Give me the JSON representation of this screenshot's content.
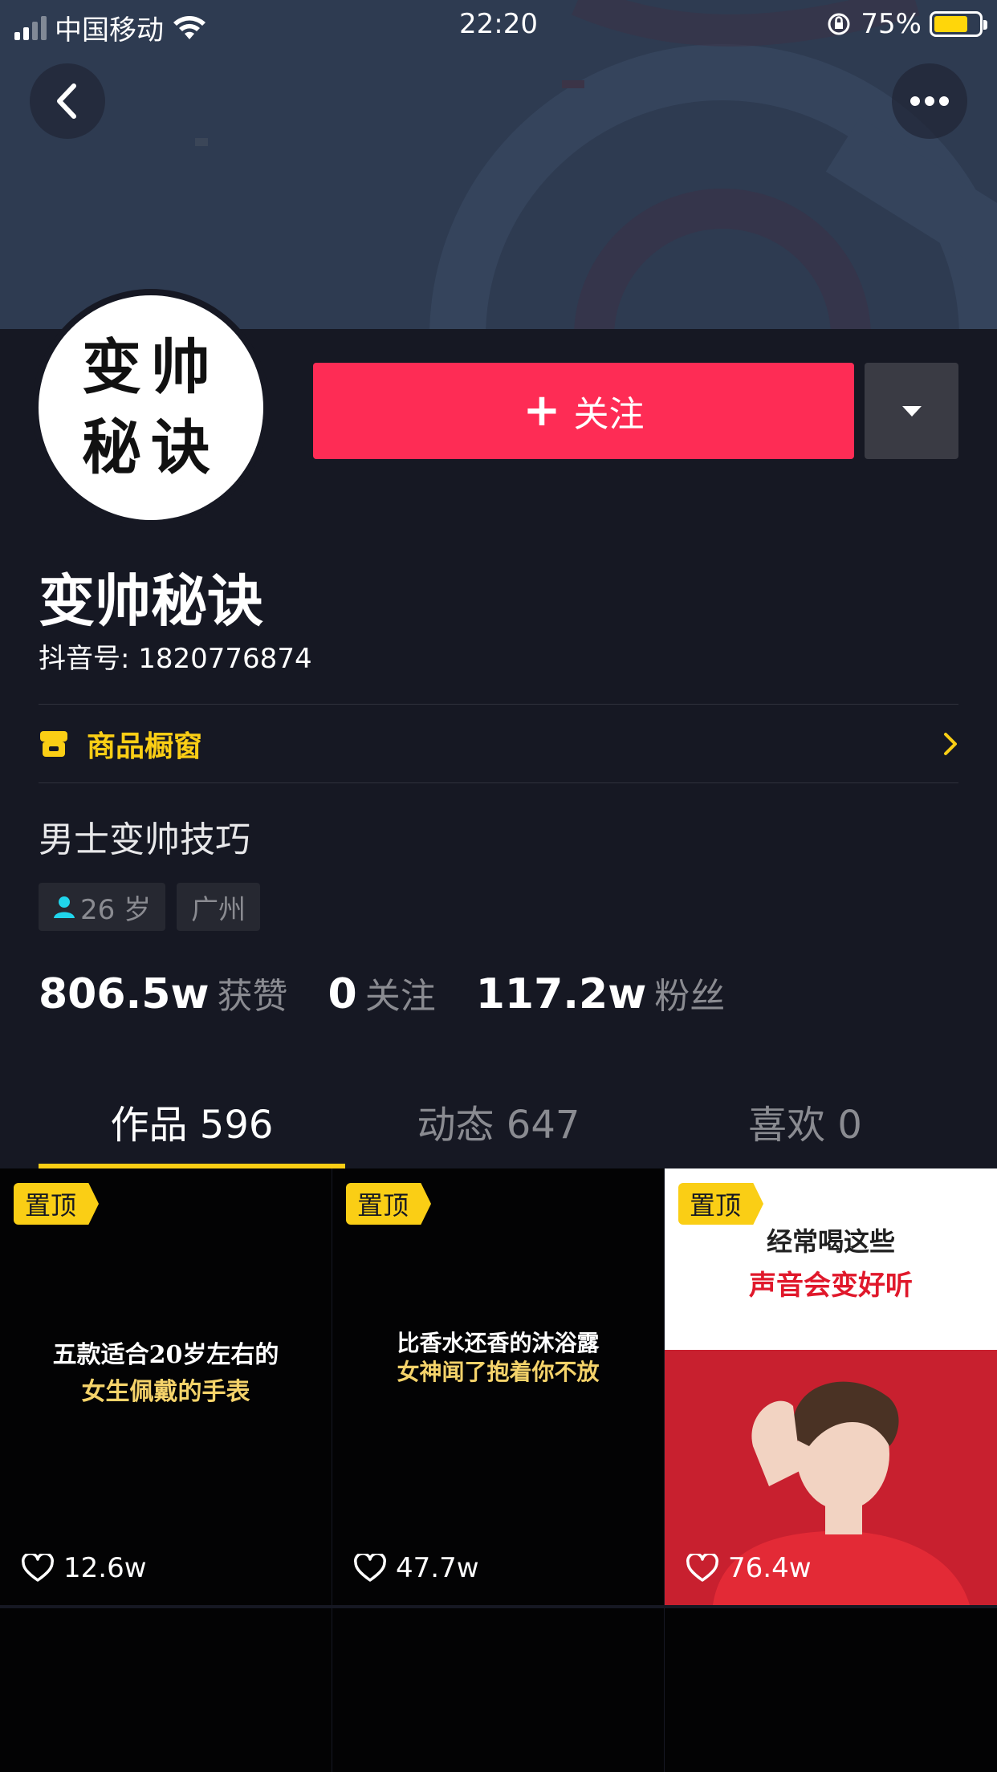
{
  "status_bar": {
    "carrier": "中国移动",
    "time": "22:20",
    "battery": "75%",
    "battery_level": 0.75
  },
  "profile": {
    "avatar_text_line1": "变帅",
    "avatar_text_line2": "秘诀",
    "follow_label": "关注",
    "name": "变帅秘诀",
    "douyin_id": "抖音号: 1820776874",
    "shop_label": "商品橱窗",
    "bio": "男士变帅技巧",
    "age_tag": "26 岁",
    "location_tag": "广州"
  },
  "stats": [
    {
      "num": "806.5w",
      "label": "获赞"
    },
    {
      "num": "0",
      "label": "关注"
    },
    {
      "num": "117.2w",
      "label": "粉丝"
    }
  ],
  "tabs": [
    {
      "label": "作品 596",
      "active": true
    },
    {
      "label": "动态 647",
      "active": false
    },
    {
      "label": "喜欢 0",
      "active": false
    }
  ],
  "videos": [
    {
      "pin": "置顶",
      "line1": "五款适合20岁左右的",
      "line2": "女生佩戴的手表",
      "likes": "12.6w"
    },
    {
      "pin": "置顶",
      "line1": "比香水还香的沐浴露",
      "line2": "女神闻了抱着你不放",
      "likes": "47.7w"
    },
    {
      "pin": "置顶",
      "line1": "经常喝这些",
      "line2": "声音会变好听",
      "likes": "76.4w"
    }
  ],
  "colors": {
    "accent_red": "#fe2c55",
    "accent_yellow": "#face15",
    "background": "#161823"
  }
}
